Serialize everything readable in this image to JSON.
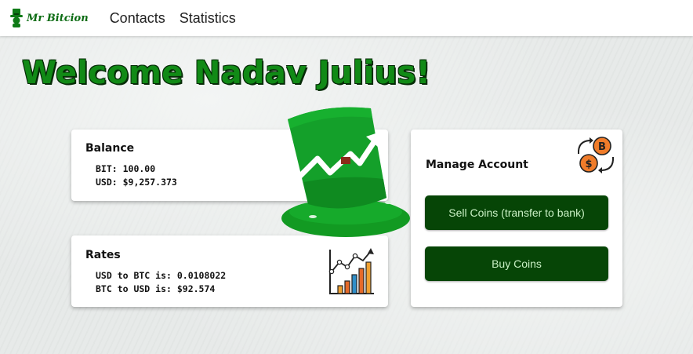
{
  "brand": {
    "name": "Mr Bitcion",
    "logo_icon": "leprechaun-hat-icon",
    "color": "#0b6b12"
  },
  "nav": {
    "contacts": "Contacts",
    "statistics": "Statistics"
  },
  "welcome": {
    "text": "Welcome Nadav Julius!",
    "color": "#118a16"
  },
  "balance": {
    "title": "Balance",
    "lines": [
      "BIT: 100.00",
      "USD: $9,257.373"
    ]
  },
  "rates": {
    "title": "Rates",
    "icon": "growth-chart-icon",
    "lines": [
      "USD to BTC is: 0.0108022",
      "BTC to USD is: $92.574"
    ]
  },
  "manage": {
    "title": "Manage Account",
    "icon": "currency-exchange-icon",
    "sell_label": "Sell Coins (transfer to bank)",
    "buy_label": "Buy Coins"
  },
  "colors": {
    "button_bg": "#064506",
    "button_text": "#c9f0c4",
    "hat_green": "#14a02a"
  },
  "decor": {
    "hat_icon": "green-top-hat-icon"
  }
}
